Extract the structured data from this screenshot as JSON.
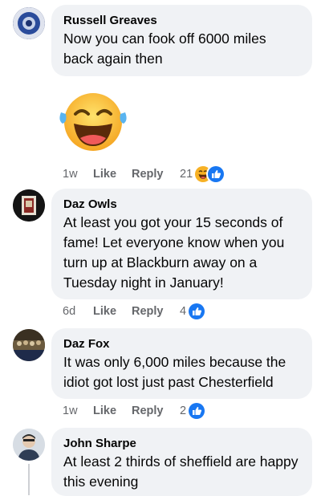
{
  "comments": [
    {
      "author": "Russell Greaves",
      "text": "Now you can fook off 6000 miles back again then",
      "time": "1w",
      "like_label": "Like",
      "reply_label": "Reply",
      "reaction_count": "21",
      "reactions": [
        "haha-icon",
        "like-icon"
      ]
    },
    {
      "author": "Daz Owls",
      "text": "At least you got your 15 seconds of fame! Let everyone know when you turn up at Blackburn away on a Tuesday night in January!",
      "time": "6d",
      "like_label": "Like",
      "reply_label": "Reply",
      "reaction_count": "4",
      "reactions": [
        "like-icon"
      ]
    },
    {
      "author": "Daz Fox",
      "text": "It was only 6,000 miles because the idiot got lost just past Chesterfield",
      "time": "1w",
      "like_label": "Like",
      "reply_label": "Reply",
      "reaction_count": "2",
      "reactions": [
        "like-icon"
      ]
    },
    {
      "author": "John Sharpe",
      "text": "At least 2 thirds of sheffield are happy this evening"
    }
  ],
  "colors": {
    "bubble": "#f0f2f5",
    "meta_text": "#65676b",
    "like_blue": "#1877f2",
    "haha_yellow": "#f7b125"
  }
}
